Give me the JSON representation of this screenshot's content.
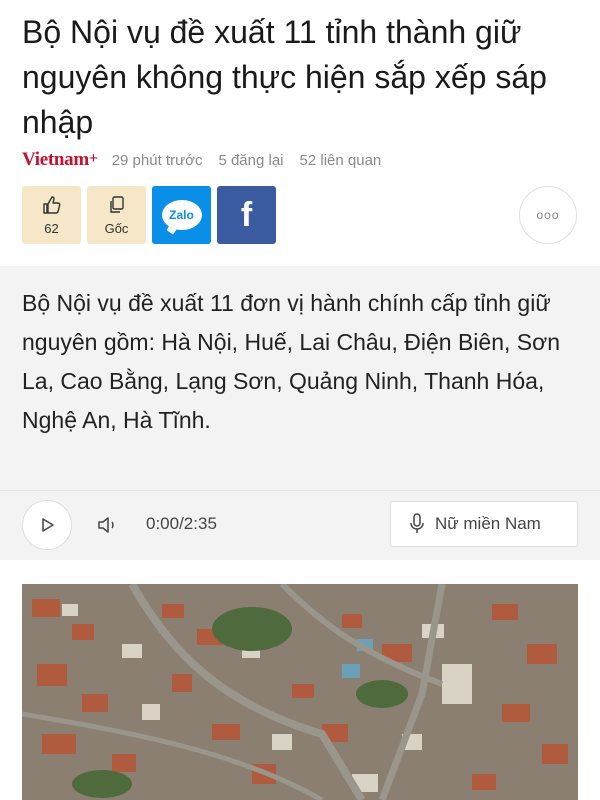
{
  "article": {
    "title": "Bộ Nội vụ đề xuất 11 tỉnh thành giữ nguyên không thực hiện sắp xếp sáp nhập",
    "source": "Vietnam",
    "source_suffix": "+",
    "time_ago": "29 phút trước",
    "reposts": "5 đăng lại",
    "related": "52 liên quan",
    "summary": "Bộ Nội vụ đề xuất 11 đơn vị hành chính cấp tỉnh giữ nguyên gồm: Hà Nội, Huế, Lai Châu, Điện Biên, Sơn La, Cao Bằng, Lạng Sơn, Quảng Ninh, Thanh Hóa, Nghệ An, Hà Tĩnh."
  },
  "actions": {
    "like_count": "62",
    "original_label": "Gốc",
    "zalo_label": "Zalo",
    "facebook_label": "f",
    "more_label": "ooo"
  },
  "player": {
    "time": "0:00/2:35",
    "voice": "Nữ miền Nam"
  },
  "colors": {
    "brand": "#c8102e",
    "action_bg": "#f5e7c8",
    "zalo": "#0a8fe8",
    "facebook": "#3b5ba0",
    "summary_bg": "#f3f3f3"
  },
  "icons": [
    "thumbs-up-icon",
    "copy-icon",
    "zalo-icon",
    "facebook-icon",
    "more-icon",
    "play-icon",
    "speaker-icon",
    "microphone-icon"
  ]
}
